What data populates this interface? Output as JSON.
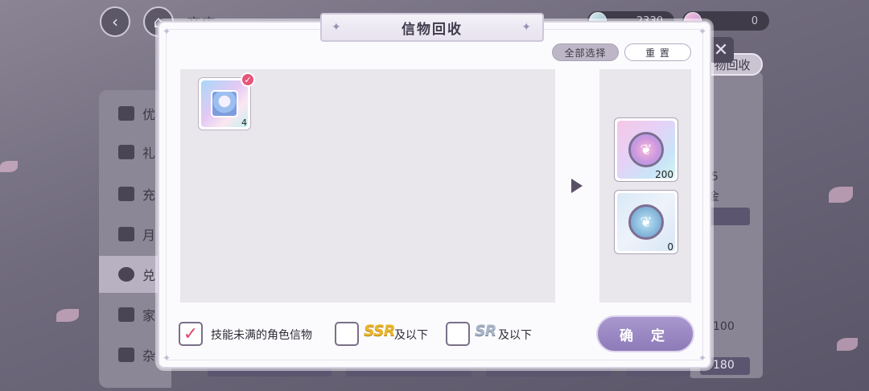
{
  "background": {
    "side_menu": [
      "优",
      "礼",
      "充",
      "月",
      "兑",
      "家",
      "杂"
    ],
    "side_menu_active_index": 4,
    "header_title": "商店",
    "resources": [
      "2330",
      "0"
    ],
    "right_tab_label": "物回收",
    "right_texts": [
      "5",
      "金",
      "100",
      "180"
    ]
  },
  "modal": {
    "title": "信物回收",
    "select_all_label": "全部选择",
    "reset_label": "重 置",
    "input_items": [
      {
        "name": "character-token",
        "count": "4",
        "selected": true
      }
    ],
    "output_items": [
      {
        "type": "pink-coin",
        "count": "200"
      },
      {
        "type": "blue-coin",
        "count": "0"
      }
    ],
    "filters": [
      {
        "label": "技能未满的角色信物",
        "checked": true
      },
      {
        "rarity": "SSR",
        "label": "及以下",
        "checked": false
      },
      {
        "rarity": "SR",
        "label": "及以下",
        "checked": false
      }
    ],
    "confirm_label": "确 定"
  },
  "colors": {
    "accent": "#8d7bb8",
    "check": "#e0476f",
    "ssr": "#e9b62e",
    "sr": "#a9b6c8"
  },
  "icons": [
    "back-arrow-icon",
    "home-icon",
    "close-icon",
    "checkmark-icon",
    "arrow-right-icon",
    "butterfly-coin-icon"
  ]
}
